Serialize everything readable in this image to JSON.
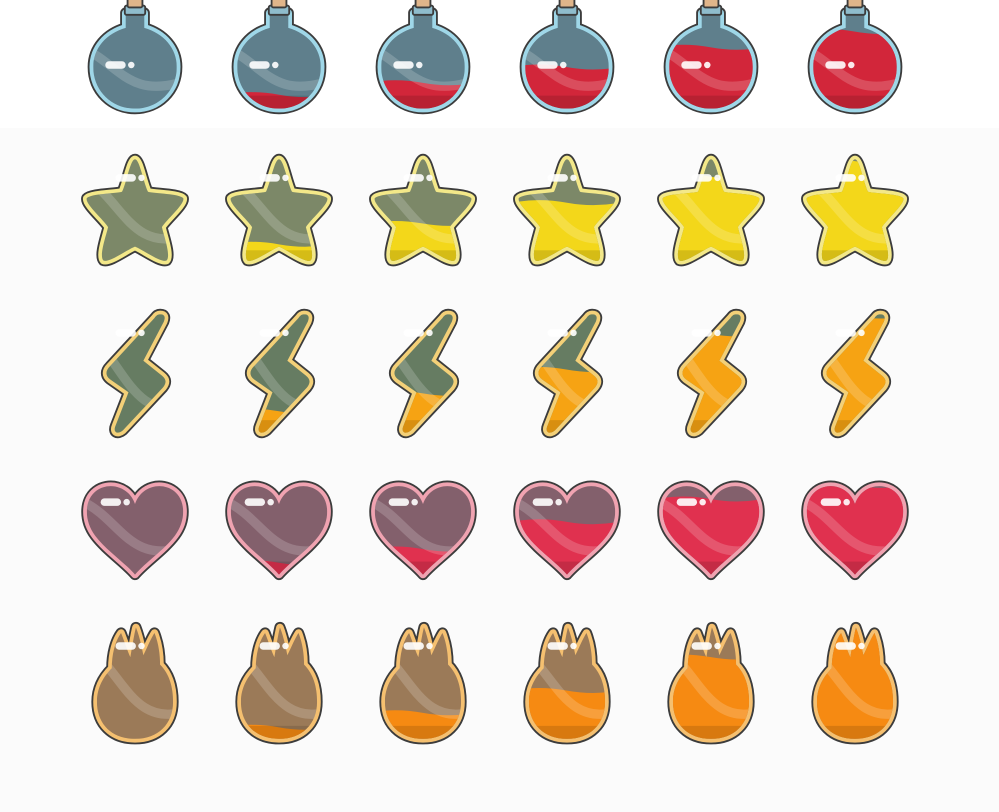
{
  "colors": {
    "background": "#fbfbfb",
    "empty_glass": {
      "potion": "#5f7f8c",
      "star": "#7c8868",
      "lightning": "#667c62",
      "heart": "#83606c",
      "flame": "#9b7a58"
    },
    "fill": {
      "potion": "#d2263a",
      "star": "#f3d71a",
      "lightning": "#f6a313",
      "heart": "#e0314f",
      "flame": "#f68a12"
    },
    "outline": {
      "potion": "#9fd7e8",
      "star": "#f3e889",
      "lightning": "#f3d078",
      "heart": "#f0a3b1",
      "flame": "#f5c070"
    }
  },
  "icon_sets": [
    {
      "icon": "potion-bottle-icon",
      "fill_levels": [
        0,
        0.2,
        0.35,
        0.55,
        0.8,
        1.0
      ]
    },
    {
      "icon": "star-icon",
      "fill_levels": [
        0,
        0.2,
        0.4,
        0.6,
        0.85,
        1.0
      ]
    },
    {
      "icon": "lightning-bolt-icon",
      "fill_levels": [
        0,
        0.2,
        0.35,
        0.55,
        0.85,
        1.0
      ]
    },
    {
      "icon": "heart-icon",
      "fill_levels": [
        0,
        0.15,
        0.3,
        0.6,
        0.85,
        1.0
      ]
    },
    {
      "icon": "flame-icon",
      "fill_levels": [
        0,
        0.12,
        0.25,
        0.45,
        0.75,
        1.0
      ]
    }
  ]
}
